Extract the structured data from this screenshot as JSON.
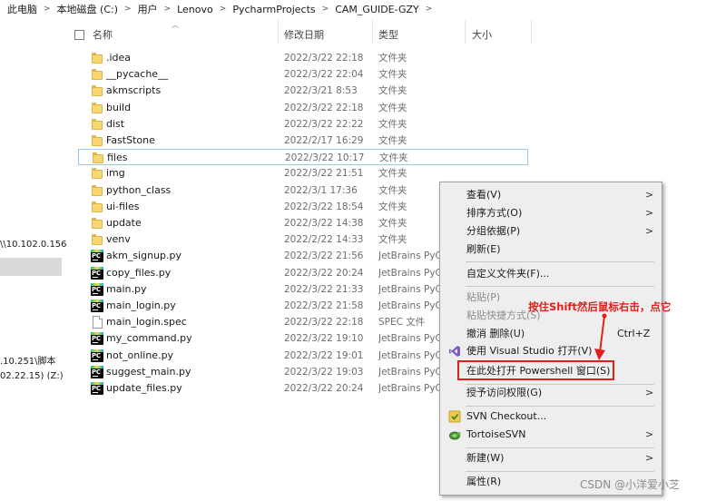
{
  "breadcrumb": [
    "此电脑",
    "本地磁盘 (C:)",
    "用户",
    "Lenovo",
    "PycharmProjects",
    "CAM_GUIDE-GZY"
  ],
  "left_nav": {
    "frag1": "\\\\10.102.0.156",
    "frag2": ".10.251\\脚本",
    "frag3": "02.22.15) (Z:)"
  },
  "columns": {
    "name": "名称",
    "date": "修改日期",
    "type": "类型",
    "size": "大小"
  },
  "files": [
    {
      "name": ".idea",
      "date": "2022/3/22 22:18",
      "type": "文件夹",
      "icon": "folder-icon"
    },
    {
      "name": "__pycache__",
      "date": "2022/3/22 22:04",
      "type": "文件夹",
      "icon": "folder-icon"
    },
    {
      "name": "akmscripts",
      "date": "2022/3/21 8:53",
      "type": "文件夹",
      "icon": "folder-icon"
    },
    {
      "name": "build",
      "date": "2022/3/22 22:18",
      "type": "文件夹",
      "icon": "folder-icon"
    },
    {
      "name": "dist",
      "date": "2022/3/22 22:22",
      "type": "文件夹",
      "icon": "folder-icon"
    },
    {
      "name": "FastStone",
      "date": "2022/2/17 16:29",
      "type": "文件夹",
      "icon": "folder-icon"
    },
    {
      "name": "files",
      "date": "2022/3/22 10:17",
      "type": "文件夹",
      "icon": "folder-icon"
    },
    {
      "name": "img",
      "date": "2022/3/22 21:51",
      "type": "文件夹",
      "icon": "folder-icon"
    },
    {
      "name": "python_class",
      "date": "2022/3/1 17:36",
      "type": "文件夹",
      "icon": "folder-icon"
    },
    {
      "name": "ui-files",
      "date": "2022/3/22 18:54",
      "type": "文件夹",
      "icon": "folder-icon"
    },
    {
      "name": "update",
      "date": "2022/3/22 14:38",
      "type": "文件夹",
      "icon": "folder-icon"
    },
    {
      "name": "venv",
      "date": "2022/2/22 14:33",
      "type": "文件夹",
      "icon": "folder-icon"
    },
    {
      "name": "akm_signup.py",
      "date": "2022/3/22 21:56",
      "type": "JetBrains PyC",
      "icon": "pycharm-file-icon"
    },
    {
      "name": "copy_files.py",
      "date": "2022/3/22 20:24",
      "type": "JetBrains PyC",
      "icon": "pycharm-file-icon"
    },
    {
      "name": "main.py",
      "date": "2022/3/22 21:33",
      "type": "JetBrains PyC",
      "icon": "pycharm-file-icon"
    },
    {
      "name": "main_login.py",
      "date": "2022/3/22 21:58",
      "type": "JetBrains PyC",
      "icon": "pycharm-file-icon"
    },
    {
      "name": "main_login.spec",
      "date": "2022/3/22 22:18",
      "type": "SPEC 文件",
      "icon": "document-icon"
    },
    {
      "name": "my_command.py",
      "date": "2022/3/22 19:10",
      "type": "JetBrains PyC",
      "icon": "pycharm-file-icon"
    },
    {
      "name": "not_online.py",
      "date": "2022/3/22 19:01",
      "type": "JetBrains PyC",
      "icon": "pycharm-file-icon"
    },
    {
      "name": "suggest_main.py",
      "date": "2022/3/22 19:03",
      "type": "JetBrains PyC",
      "icon": "pycharm-file-icon"
    },
    {
      "name": "update_files.py",
      "date": "2022/3/22 20:24",
      "type": "JetBrains PyC",
      "icon": "pycharm-file-icon"
    }
  ],
  "context_menu": {
    "view": "查看(V)",
    "sort": "排序方式(O)",
    "group": "分组依据(P)",
    "refresh": "刷新(E)",
    "customize": "自定义文件夹(F)...",
    "paste": "粘贴(P)",
    "paste_shortcut": "粘贴快捷方式(S)",
    "undo_delete": "撤消 删除(U)",
    "undo_shortcut": "Ctrl+Z",
    "open_vs": "使用 Visual Studio 打开(V)",
    "open_powershell": "在此处打开 Powershell 窗口(S)",
    "grant_access": "授予访问权限(G)",
    "svn_checkout": "SVN Checkout...",
    "tortoise": "TortoiseSVN",
    "new": "新建(W)",
    "properties": "属性(R)"
  },
  "annotation": "按住Shift然后鼠标右击，点它",
  "watermark": "CSDN @小洋爱小芝",
  "colors": {
    "highlight": "#e0201a",
    "selection_border": "#99c9ef",
    "menu_bg": "#eeeeee"
  }
}
